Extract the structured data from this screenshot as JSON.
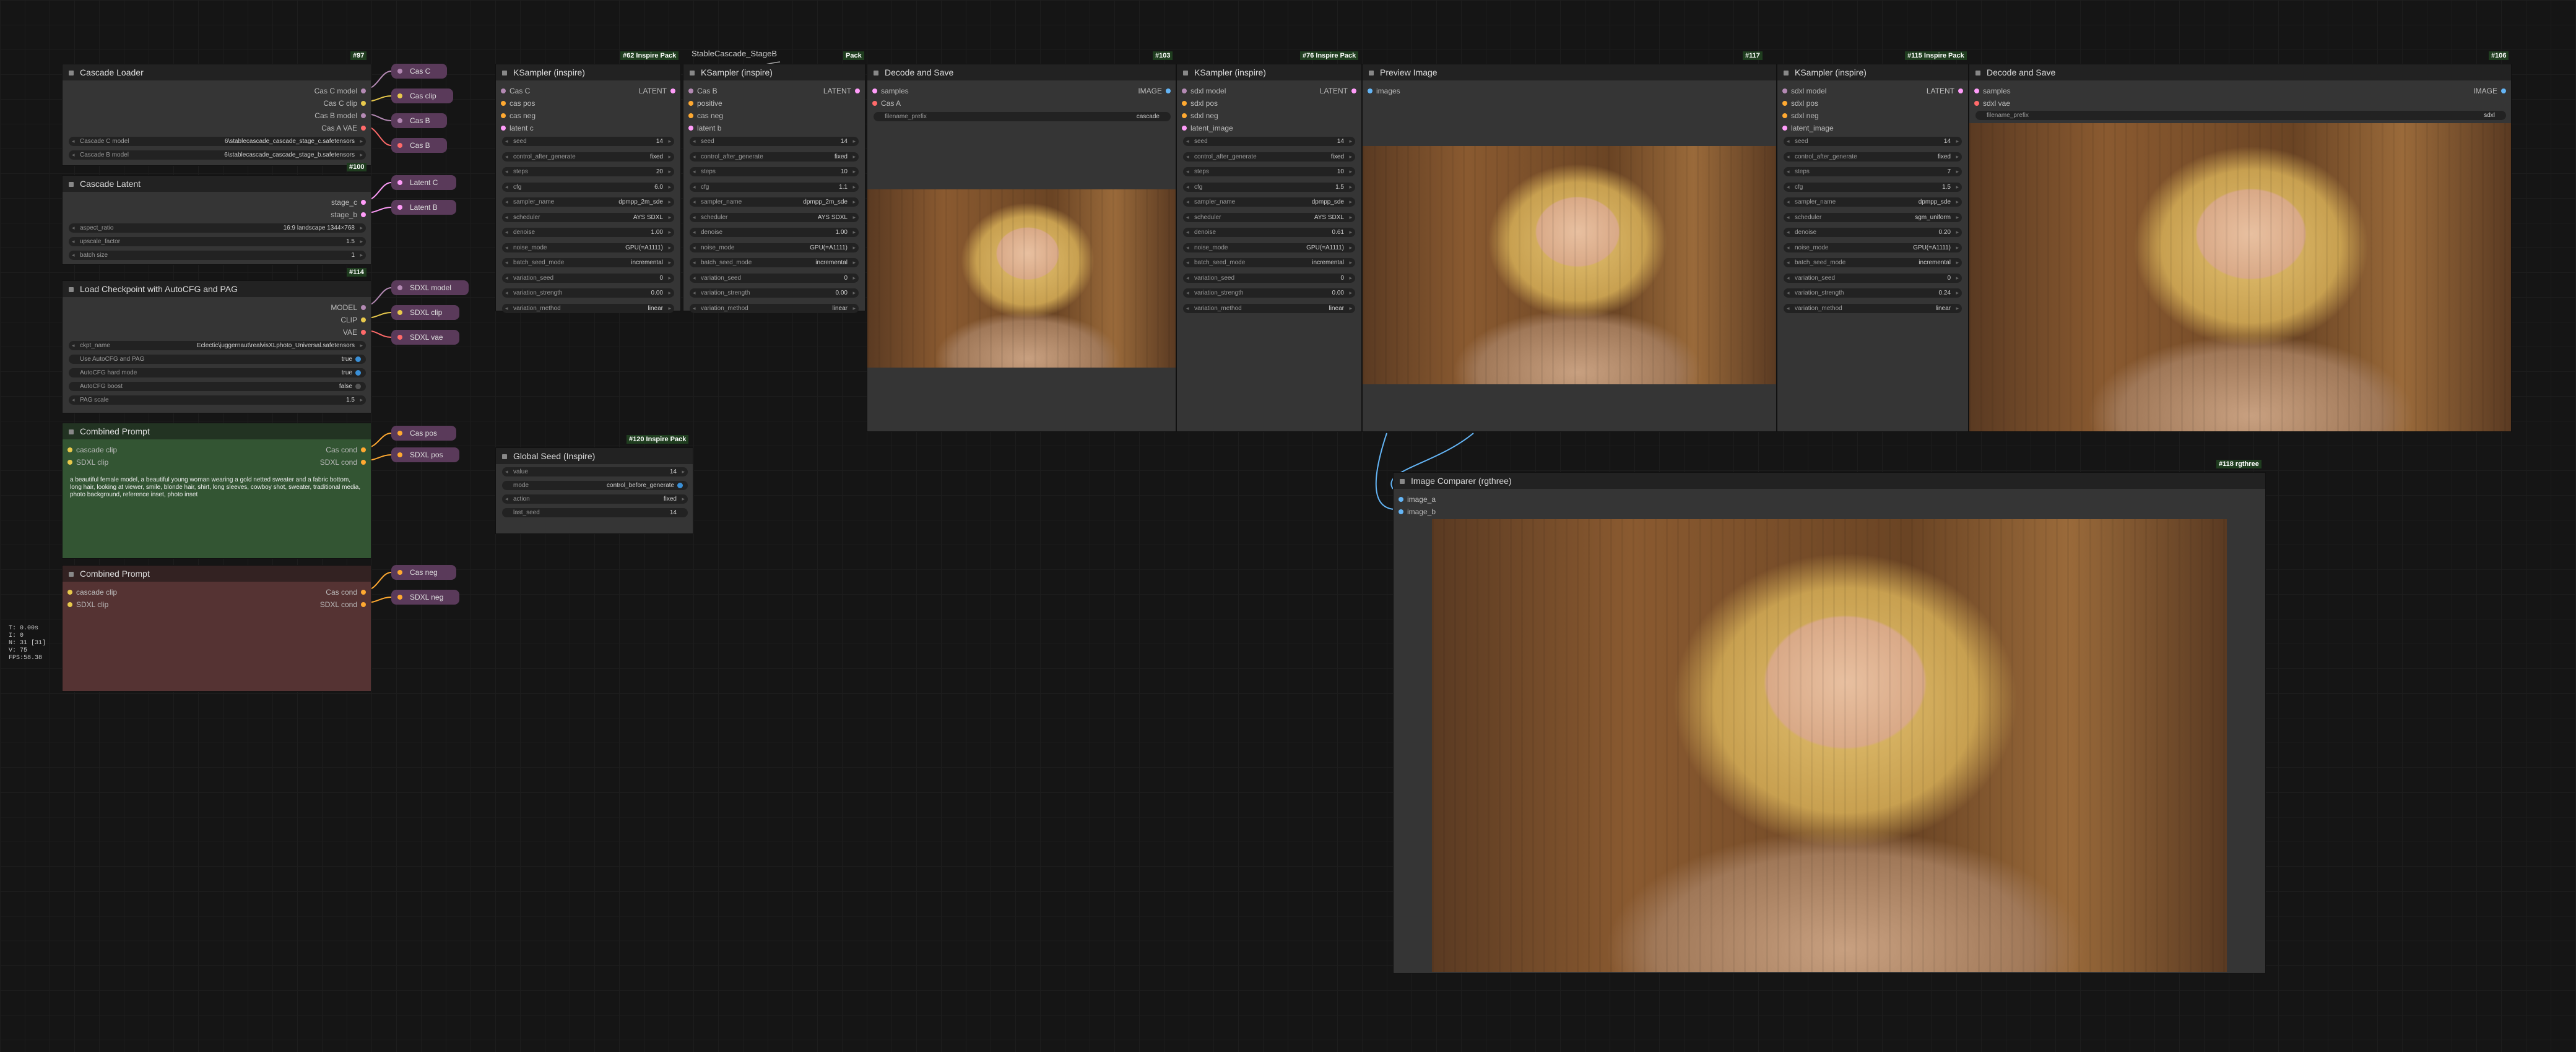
{
  "nodes": {
    "cascade_loader": {
      "title": "Cascade Loader",
      "badge": "#97",
      "outputs": [
        "Cas C model",
        "Cas C clip",
        "Cas B model",
        "Cas A VAE"
      ],
      "widgets": [
        {
          "k": "Cascade C model",
          "v": "6\\stablecascade_cascade_stage_c.safetensors"
        },
        {
          "k": "Cascade B model",
          "v": "6\\stablecascade_cascade_stage_b.safetensors"
        }
      ]
    },
    "cascade_latent": {
      "title": "Cascade Latent",
      "badge": "#100",
      "outputs": [
        "stage_c",
        "stage_b"
      ],
      "widgets": [
        {
          "k": "aspect_ratio",
          "v": "16:9 landscape 1344×768"
        },
        {
          "k": "upscale_factor",
          "v": "1.5"
        },
        {
          "k": "batch size",
          "v": "1"
        }
      ]
    },
    "checkpoint": {
      "title": "Load Checkpoint with AutoCFG and PAG",
      "badge": "#114",
      "outputs": [
        "MODEL",
        "CLIP",
        "VAE"
      ],
      "widgets": [
        {
          "k": "ckpt_name",
          "v": "Eclectic\\juggernaut\\realvisXLphoto_Universal.safetensors"
        },
        {
          "k": "Use AutoCFG and PAG",
          "v": "true"
        },
        {
          "k": "AutoCFG hard mode",
          "v": "true"
        },
        {
          "k": "AutoCFG boost",
          "v": "false"
        },
        {
          "k": "PAG scale",
          "v": "1.5"
        }
      ]
    },
    "prompt_pos": {
      "title": "Combined Prompt",
      "inputs": [
        "cascade clip",
        "SDXL clip"
      ],
      "outputs": [
        "Cas cond",
        "SDXL cond"
      ],
      "text": "a beautiful female model, a beautiful young woman wearing a gold netted sweater and a fabric bottom, long hair, looking at viewer, smile, blonde hair, shirt, long sleeves, cowboy shot, sweater, traditional media, photo background, reference inset, photo inset"
    },
    "prompt_neg": {
      "title": "Combined Prompt",
      "inputs": [
        "cascade clip",
        "SDXL clip"
      ],
      "outputs": [
        "Cas cond",
        "SDXL cond"
      ]
    },
    "ks1": {
      "title": "KSampler (inspire)",
      "badge": "#62 Inspire Pack",
      "inputs": [
        "Cas C",
        "cas pos",
        "cas neg",
        "latent c"
      ],
      "output": "LATENT",
      "widgets": [
        {
          "k": "seed",
          "v": "14"
        },
        {
          "k": "control_after_generate",
          "v": "fixed"
        },
        {
          "k": "steps",
          "v": "20"
        },
        {
          "k": "cfg",
          "v": "6.0"
        },
        {
          "k": "sampler_name",
          "v": "dpmpp_2m_sde"
        },
        {
          "k": "scheduler",
          "v": "AYS SDXL"
        },
        {
          "k": "denoise",
          "v": "1.00"
        },
        {
          "k": "noise_mode",
          "v": "GPU(=A1111)"
        },
        {
          "k": "batch_seed_mode",
          "v": "incremental"
        },
        {
          "k": "variation_seed",
          "v": "0"
        },
        {
          "k": "variation_strength",
          "v": "0.00"
        },
        {
          "k": "variation_method",
          "v": "linear"
        }
      ]
    },
    "ks2": {
      "title": "KSampler (inspire)",
      "badge": "StableCascade_StageB",
      "inputs": [
        "Cas B",
        "positive",
        "cas neg",
        "latent b"
      ],
      "output": "LATENT",
      "widgets": [
        {
          "k": "seed",
          "v": "14"
        },
        {
          "k": "control_after_generate",
          "v": "fixed"
        },
        {
          "k": "steps",
          "v": "10"
        },
        {
          "k": "cfg",
          "v": "1.1"
        },
        {
          "k": "sampler_name",
          "v": "dpmpp_2m_sde"
        },
        {
          "k": "scheduler",
          "v": "AYS SDXL"
        },
        {
          "k": "denoise",
          "v": "1.00"
        },
        {
          "k": "noise_mode",
          "v": "GPU(=A1111)"
        },
        {
          "k": "batch_seed_mode",
          "v": "incremental"
        },
        {
          "k": "variation_seed",
          "v": "0"
        },
        {
          "k": "variation_strength",
          "v": "0.00"
        },
        {
          "k": "variation_method",
          "v": "linear"
        }
      ]
    },
    "decode1": {
      "title": "Decode and Save",
      "badge": "#103",
      "inputs": [
        "samples",
        "Cas A"
      ],
      "output": "IMAGE",
      "prefix_k": "filename_prefix",
      "prefix_v": "cascade"
    },
    "ks3": {
      "title": "KSampler (inspire)",
      "badge": "#76 Inspire Pack",
      "inputs": [
        "sdxl model",
        "sdxl pos",
        "sdxl neg",
        "latent_image"
      ],
      "output": "LATENT",
      "widgets": [
        {
          "k": "seed",
          "v": "14"
        },
        {
          "k": "control_after_generate",
          "v": "fixed"
        },
        {
          "k": "steps",
          "v": "10"
        },
        {
          "k": "cfg",
          "v": "1.5"
        },
        {
          "k": "sampler_name",
          "v": "dpmpp_sde"
        },
        {
          "k": "scheduler",
          "v": "AYS SDXL"
        },
        {
          "k": "denoise",
          "v": "0.61"
        },
        {
          "k": "noise_mode",
          "v": "GPU(=A1111)"
        },
        {
          "k": "batch_seed_mode",
          "v": "incremental"
        },
        {
          "k": "variation_seed",
          "v": "0"
        },
        {
          "k": "variation_strength",
          "v": "0.00"
        },
        {
          "k": "variation_method",
          "v": "linear"
        }
      ]
    },
    "preview": {
      "title": "Preview Image",
      "badge": "#117",
      "inputs": [
        "images"
      ]
    },
    "ks4": {
      "title": "KSampler (inspire)",
      "badge": "#115 Inspire Pack",
      "inputs": [
        "sdxl model",
        "sdxl pos",
        "sdxl neg",
        "latent_image"
      ],
      "output": "LATENT",
      "widgets": [
        {
          "k": "seed",
          "v": "14"
        },
        {
          "k": "control_after_generate",
          "v": "fixed"
        },
        {
          "k": "steps",
          "v": "7"
        },
        {
          "k": "cfg",
          "v": "1.5"
        },
        {
          "k": "sampler_name",
          "v": "dpmpp_sde"
        },
        {
          "k": "scheduler",
          "v": "sgm_uniform"
        },
        {
          "k": "denoise",
          "v": "0.20"
        },
        {
          "k": "noise_mode",
          "v": "GPU(=A1111)"
        },
        {
          "k": "batch_seed_mode",
          "v": "incremental"
        },
        {
          "k": "variation_seed",
          "v": "0"
        },
        {
          "k": "variation_strength",
          "v": "0.24"
        },
        {
          "k": "variation_method",
          "v": "linear"
        }
      ]
    },
    "decode2": {
      "title": "Decode and Save",
      "badge": "#106",
      "inputs": [
        "samples",
        "sdxl vae"
      ],
      "output": "IMAGE",
      "prefix_k": "filename_prefix",
      "prefix_v": "sdxl"
    },
    "seed": {
      "title": "Global Seed (Inspire)",
      "badge": "#120 Inspire Pack",
      "widgets": [
        {
          "k": "value",
          "v": "14"
        },
        {
          "k": "mode",
          "v": "control_before_generate"
        },
        {
          "k": "action",
          "v": "fixed"
        },
        {
          "k": "last_seed",
          "v": "14"
        }
      ]
    },
    "comparer": {
      "title": "Image Comparer (rgthree)",
      "badge": "#118 rgthree",
      "inputs": [
        "image_a",
        "image_b"
      ]
    }
  },
  "reroutes": [
    "Cas C",
    "Cas clip",
    "Cas B",
    "Cas B",
    "Latent C",
    "Latent B",
    "SDXL model",
    "SDXL clip",
    "SDXL vae",
    "Cas pos",
    "SDXL pos",
    "Cas neg",
    "SDXL neg"
  ],
  "misc_badges": {
    "b1": "Pack",
    "b2": "#100"
  },
  "stats": [
    "T: 0.00s",
    "I: 0",
    "N: 31 [31]",
    "V: 75",
    "FPS:58.38"
  ]
}
